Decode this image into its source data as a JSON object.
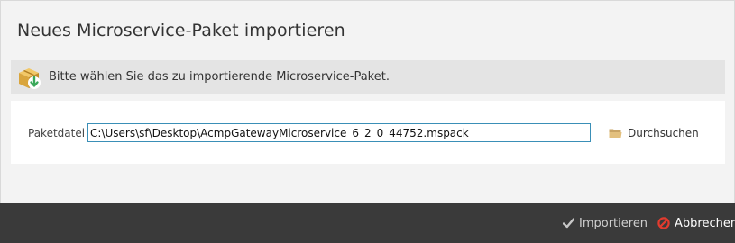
{
  "dialog": {
    "title": "Neues Microservice-Paket importieren",
    "info_icon": "package-download-icon",
    "info_text": "Bitte wählen Sie das zu importierende Microservice-Paket."
  },
  "form": {
    "file_label": "Paketdatei",
    "file_value": "C:\\Users\\sf\\Desktop\\AcmpGatewayMicroservice_6_2_0_44752.mspack",
    "browse_icon": "folder-icon",
    "browse_label": "Durchsuchen"
  },
  "footer": {
    "import_icon": "checkmark-icon",
    "import_label": "Importieren",
    "cancel_icon": "cancel-icon",
    "cancel_label": "Abbrechen"
  },
  "colors": {
    "accent_border": "#3a8fb7",
    "footer_bg": "#3a3a3a",
    "cancel_red": "#e23b2e",
    "info_bar_bg": "#e4e4e4",
    "package_gold": "#d9a53d",
    "package_arrow_green": "#3aa85a"
  }
}
